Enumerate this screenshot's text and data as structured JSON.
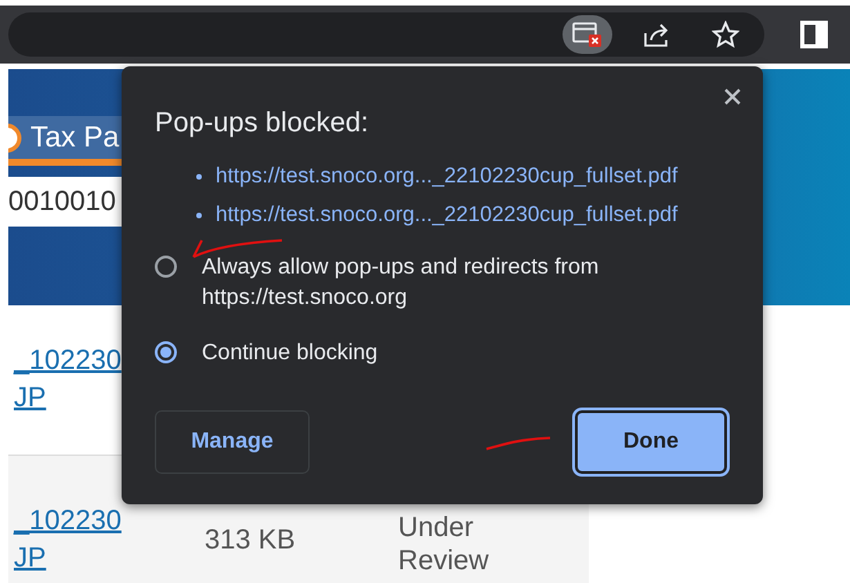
{
  "page": {
    "tab": "Tax Pa",
    "field_value": "0010010",
    "rows": [
      {
        "link_lines": [
          "_102230",
          "JP"
        ]
      },
      {
        "link_lines": [
          "_102230",
          "JP"
        ],
        "size": "313 KB",
        "status": "Under Review"
      }
    ]
  },
  "popup": {
    "title": "Pop-ups blocked:",
    "links": [
      "https://test.snoco.org..._22102230cup_fullset.pdf",
      "https://test.snoco.org..._22102230cup_fullset.pdf"
    ],
    "options": [
      {
        "label": "Always allow pop-ups and redirects from https://test.snoco.org",
        "selected": false
      },
      {
        "label": "Continue blocking",
        "selected": true
      }
    ],
    "buttons": [
      {
        "label": "Manage",
        "kind": "secondary"
      },
      {
        "label": "Done",
        "kind": "primary"
      }
    ]
  }
}
